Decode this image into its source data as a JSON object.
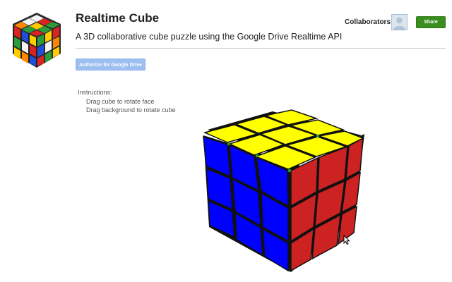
{
  "app": {
    "title": "Realtime Cube",
    "subtitle": "A 3D collaborative cube puzzle using the Google Drive Realtime API"
  },
  "toolbar": {
    "authorize_label": "Authorize for Google Drive",
    "collaborators_label": "Collaborators:",
    "share_label": "Share"
  },
  "instructions": {
    "heading": "Instructions:",
    "items": [
      "Drag cube to rotate face",
      "Drag background to rotate cube"
    ]
  },
  "colors": {
    "accent_share": "#3a8e1f",
    "authorize_disabled": "#9cbef0",
    "cube_top": "#ffff00",
    "cube_left": "#0000ff",
    "cube_right": "#cc2222"
  },
  "icons": {
    "logo": "rubiks-cube-logo",
    "avatar": "user-avatar-icon",
    "cursor": "mouse-pointer-icon"
  }
}
